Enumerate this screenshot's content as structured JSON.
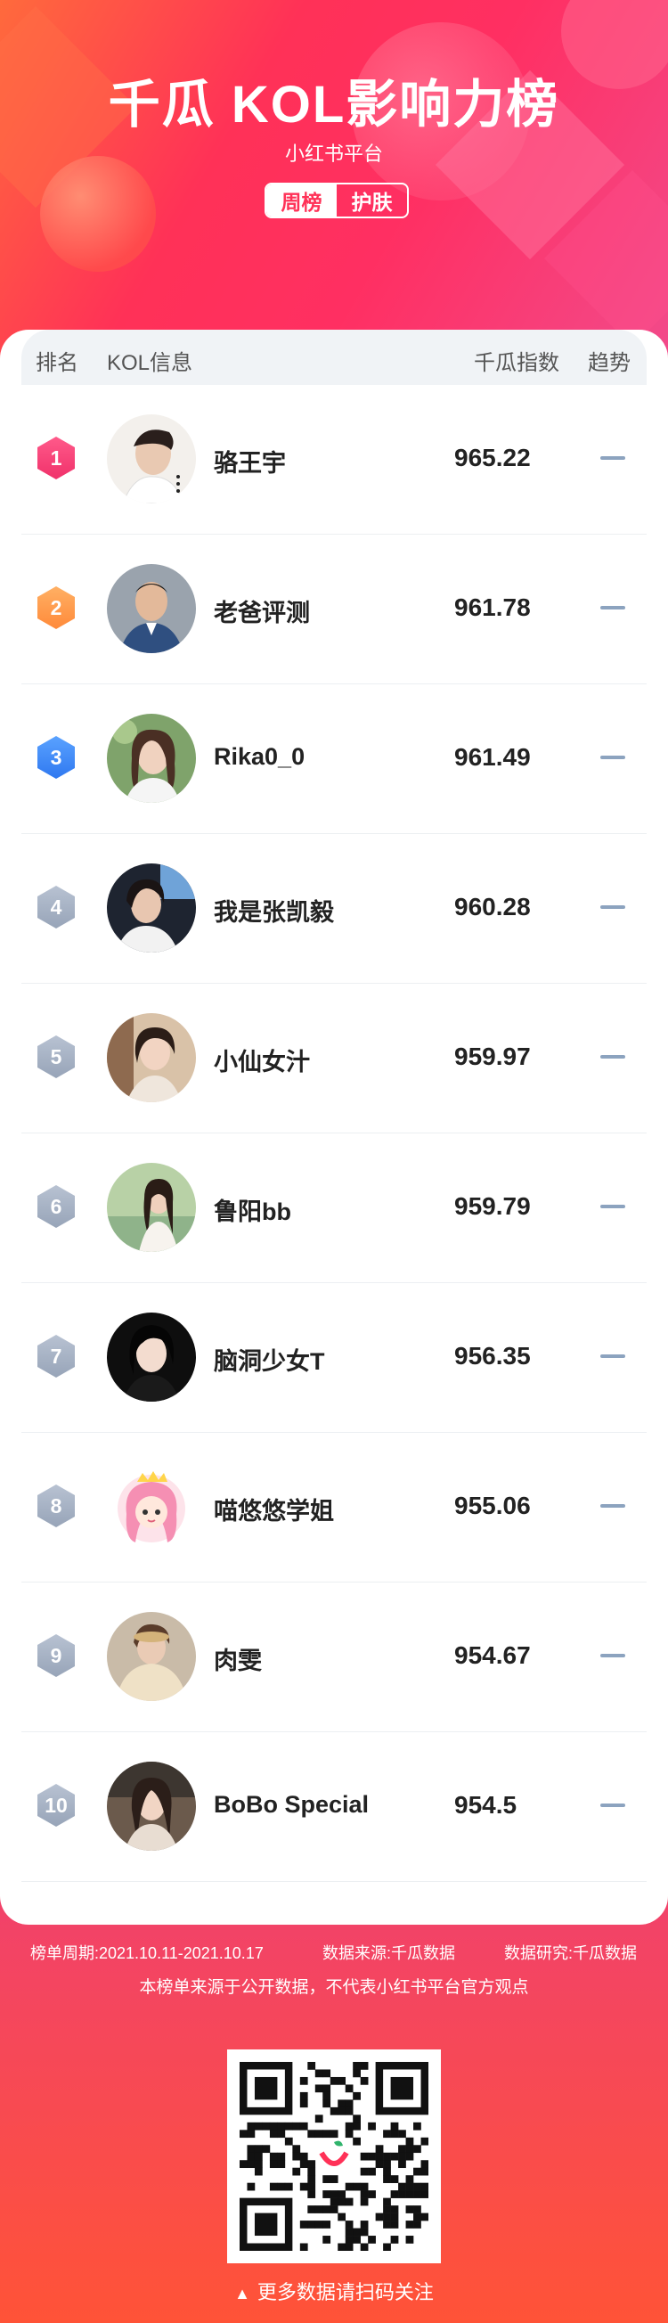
{
  "header": {
    "title": "千瓜 KOL影响力榜",
    "platform": "小红书平台",
    "tab_period": "周榜",
    "tab_category": "护肤"
  },
  "table_head": {
    "rank": "排名",
    "info": "KOL信息",
    "score": "千瓜指数",
    "trend": "趋势"
  },
  "rows": [
    {
      "rank": "1",
      "name": "骆王宇",
      "score": "965.22",
      "avatar": "avatar-1",
      "trend": "flat"
    },
    {
      "rank": "2",
      "name": "老爸评测",
      "score": "961.78",
      "avatar": "avatar-2",
      "trend": "flat"
    },
    {
      "rank": "3",
      "name": "Rika0_0",
      "score": "961.49",
      "avatar": "avatar-3",
      "trend": "flat"
    },
    {
      "rank": "4",
      "name": "我是张凯毅",
      "score": "960.28",
      "avatar": "avatar-4",
      "trend": "flat"
    },
    {
      "rank": "5",
      "name": "小仙女汁",
      "score": "959.97",
      "avatar": "avatar-5",
      "trend": "flat"
    },
    {
      "rank": "6",
      "name": "鲁阳bb",
      "score": "959.79",
      "avatar": "avatar-6",
      "trend": "flat"
    },
    {
      "rank": "7",
      "name": "脑洞少女T",
      "score": "956.35",
      "avatar": "avatar-7",
      "trend": "flat"
    },
    {
      "rank": "8",
      "name": "喵悠悠学姐",
      "score": "955.06",
      "avatar": "avatar-8",
      "trend": "flat"
    },
    {
      "rank": "9",
      "name": "肉雯",
      "score": "954.67",
      "avatar": "avatar-9",
      "trend": "flat"
    },
    {
      "rank": "10",
      "name": "BoBo Special",
      "score": "954.5",
      "avatar": "avatar-10",
      "trend": "flat"
    }
  ],
  "footer": {
    "period": "榜单周期:2021.10.11-2021.10.17",
    "source": "数据来源:千瓜数据",
    "research": "数据研究:千瓜数据",
    "disclaimer": "本榜单来源于公开数据，不代表小红书平台官方观点",
    "qr_cta": "更多数据请扫码关注",
    "cta_icon": "triangle-up-icon"
  },
  "colors": {
    "accent": "#ff3157",
    "rank1": "#f0316a",
    "rank2": "#ff8a3a",
    "rank3": "#2f78f0",
    "rank_other": "#97a4b8",
    "trend": "#8ca3bf"
  }
}
